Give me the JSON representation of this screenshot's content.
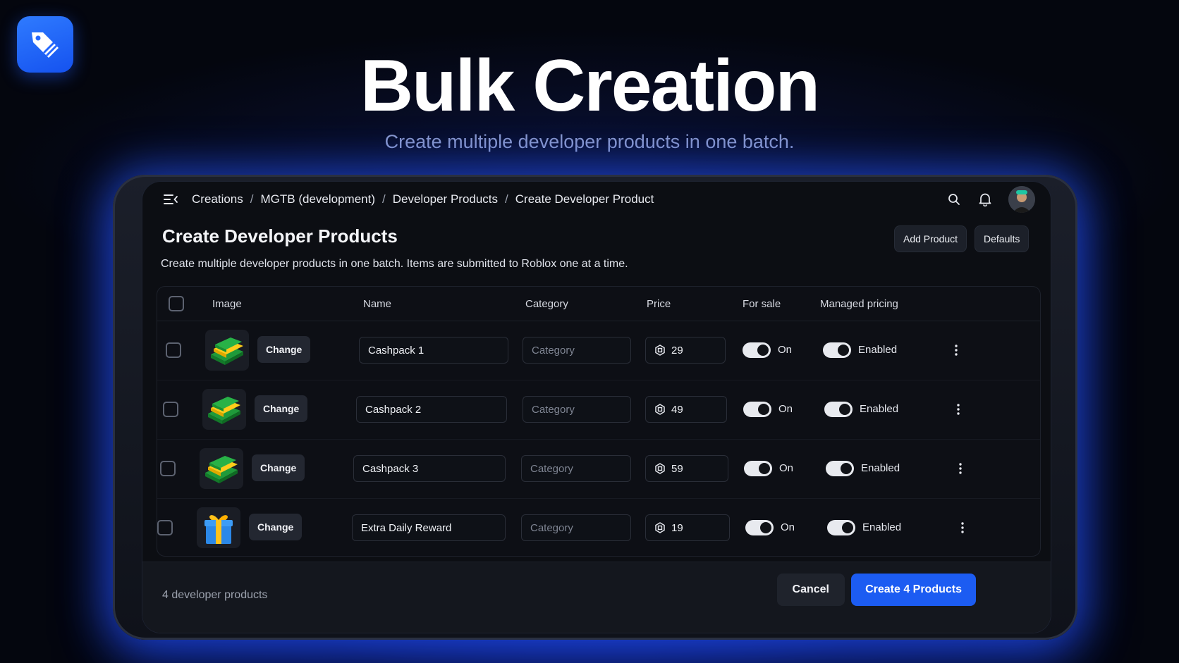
{
  "hero": {
    "title": "Bulk Creation",
    "subtitle": "Create multiple developer products in one batch."
  },
  "topbar": {
    "breadcrumbs": [
      "Creations",
      "MGTB (development)",
      "Developer Products",
      "Create Developer Product"
    ],
    "separator": "/"
  },
  "page": {
    "title": "Create Developer Products",
    "description": "Create multiple developer products in one batch. Items are submitted to Roblox one at a time.",
    "add_product_label": "Add Product",
    "defaults_label": "Defaults"
  },
  "table": {
    "headers": {
      "image": "Image",
      "name": "Name",
      "category": "Category",
      "price": "Price",
      "for_sale": "For sale",
      "managed_pricing": "Managed pricing"
    },
    "rows": [
      {
        "name": "Cashpack 1",
        "category_placeholder": "Category",
        "price": "29",
        "for_sale": "On",
        "managed": "Enabled",
        "change_label": "Change",
        "icon": "cash-stack-icon"
      },
      {
        "name": "Cashpack 2",
        "category_placeholder": "Category",
        "price": "49",
        "for_sale": "On",
        "managed": "Enabled",
        "change_label": "Change",
        "icon": "cash-stack-icon"
      },
      {
        "name": "Cashpack 3",
        "category_placeholder": "Category",
        "price": "59",
        "for_sale": "On",
        "managed": "Enabled",
        "change_label": "Change",
        "icon": "cash-stack-icon"
      },
      {
        "name": "Extra Daily Reward",
        "category_placeholder": "Category",
        "price": "19",
        "for_sale": "On",
        "managed": "Enabled",
        "change_label": "Change",
        "icon": "gift-box-icon"
      }
    ]
  },
  "footer": {
    "count_text": "4 developer products",
    "cancel_label": "Cancel",
    "create_label": "Create 4 Products"
  },
  "colors": {
    "accent": "#1c5cf2",
    "logo": "#1f66ff",
    "background": "#04060e"
  }
}
